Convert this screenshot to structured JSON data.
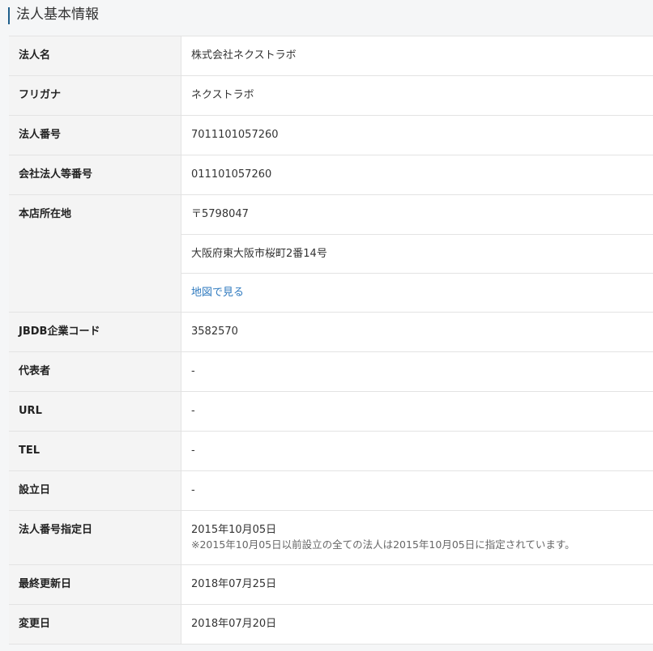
{
  "section": {
    "title": "法人基本情報"
  },
  "rows": [
    {
      "label": "法人名",
      "value": "株式会社ネクストラボ"
    },
    {
      "label": "フリガナ",
      "value": "ネクストラボ"
    },
    {
      "label": "法人番号",
      "value": "7011101057260"
    },
    {
      "label": "会社法人等番号",
      "value": "011101057260"
    },
    {
      "label": "本店所在地",
      "postal": "〒5798047",
      "address": "大阪府東大阪市桜町2番14号",
      "map_link": "地図で見る"
    },
    {
      "label": "JBDB企業コード",
      "value": "3582570"
    },
    {
      "label": "代表者",
      "value": "-"
    },
    {
      "label": "URL",
      "value": "-"
    },
    {
      "label": "TEL",
      "value": "-"
    },
    {
      "label": "設立日",
      "value": "-"
    },
    {
      "label": "法人番号指定日",
      "value": "2015年10月05日",
      "note": "※2015年10月05日以前設立の全ての法人は2015年10月05日に指定されています。"
    },
    {
      "label": "最終更新日",
      "value": "2018年07月25日"
    },
    {
      "label": "変更日",
      "value": "2018年07月20日"
    }
  ]
}
